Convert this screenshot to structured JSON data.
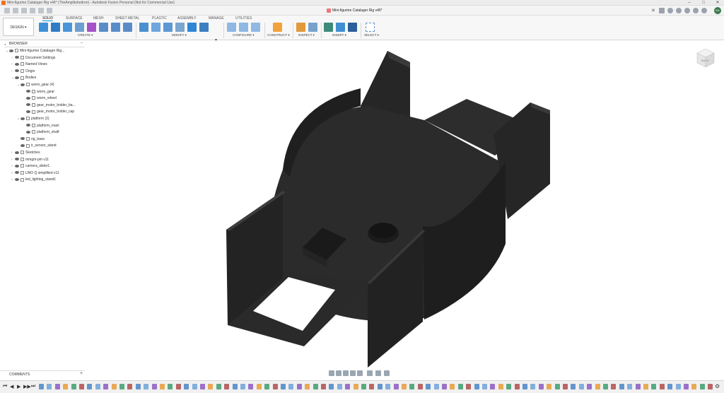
{
  "window": {
    "title": "Mini-figurine Catalager Rig v46* (TheAmplituhedron) - Autodesk Fusion Personal (Not for Commercial Use)",
    "controls": [
      "–",
      "□",
      "✕"
    ]
  },
  "doc_tab": {
    "label": "Mini-figurine Catalager Rig v46*",
    "close": "✕"
  },
  "user": {
    "initials": "KA"
  },
  "workspace": {
    "label": "DESIGN ▾"
  },
  "ws_tabs": [
    {
      "label": "SOLID",
      "active": true
    },
    {
      "label": "SURFACE"
    },
    {
      "label": "MESH"
    },
    {
      "label": "SHEET METAL"
    },
    {
      "label": "PLASTIC"
    },
    {
      "label": "ASSEMBLY"
    },
    {
      "label": "MANAGE"
    },
    {
      "label": "UTILITIES"
    }
  ],
  "groups": {
    "create": "CREATE ▾",
    "modify": "MODIFY ▾",
    "configure": "CONFIGURE ▾",
    "construct": "CONSTRUCT ▾",
    "inspect": "INSPECT ▾",
    "insert": "INSERT ▾",
    "select": "SELECT ▾"
  },
  "browser": {
    "title": "BROWSER",
    "collapse": "–",
    "rows": [
      {
        "label": "Mini-figurine Catalager Rig...",
        "depth": 0,
        "chev": "⌄"
      },
      {
        "label": "Document Settings",
        "depth": 1,
        "chev": "›"
      },
      {
        "label": "Named Views",
        "depth": 1,
        "chev": "›"
      },
      {
        "label": "Origin",
        "depth": 1,
        "chev": "›"
      },
      {
        "label": "Bodies",
        "depth": 1,
        "chev": "⌄"
      },
      {
        "label": "worm_gear (4)",
        "depth": 2,
        "chev": "⌄"
      },
      {
        "label": "worm_gear",
        "depth": 3,
        "chev": ""
      },
      {
        "label": "worm_wheel",
        "depth": 3,
        "chev": ""
      },
      {
        "label": "gear_motor_holder_ba...",
        "depth": 3,
        "chev": ""
      },
      {
        "label": "gear_motor_holder_cap",
        "depth": 3,
        "chev": ""
      },
      {
        "label": "platform (2)",
        "depth": 2,
        "chev": "⌄"
      },
      {
        "label": "platform_main",
        "depth": 3,
        "chev": ""
      },
      {
        "label": "platform_shaft",
        "depth": 3,
        "chev": ""
      },
      {
        "label": "rig_base",
        "depth": 2,
        "chev": ""
      },
      {
        "label": "ir_sensor_stand",
        "depth": 2,
        "chev": ""
      },
      {
        "label": "Sketches",
        "depth": 1,
        "chev": "›"
      },
      {
        "label": "mmgm-pm v11",
        "depth": 1,
        "chev": "›"
      },
      {
        "label": "camera_slider1",
        "depth": 1,
        "chev": "›"
      },
      {
        "label": "UNO Q simplified v11",
        "depth": 1,
        "chev": "›"
      },
      {
        "label": "led_lighting_stand1",
        "depth": 1,
        "chev": "›"
      }
    ]
  },
  "comments": {
    "label": "COMMENTS",
    "add": "+"
  },
  "viewcube": {
    "label": "BACK"
  },
  "timeline": {
    "controls": [
      "⏮",
      "◀",
      "▶",
      "▶▶",
      "⏭"
    ],
    "settings": "⚙"
  }
}
